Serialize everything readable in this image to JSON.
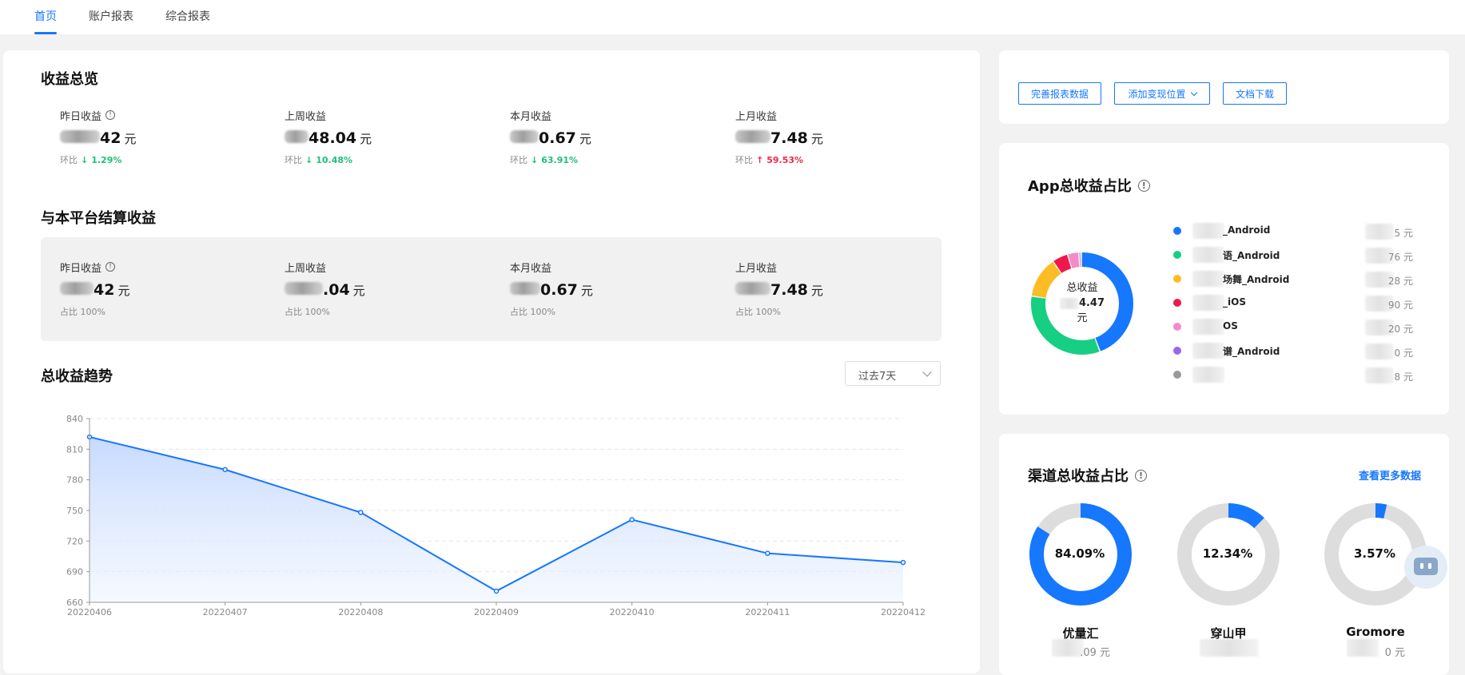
{
  "nav": {
    "tabs": [
      {
        "label": "首页",
        "active": true
      },
      {
        "label": "账户报表",
        "active": false
      },
      {
        "label": "综合报表",
        "active": false
      }
    ]
  },
  "overview": {
    "title": "收益总览",
    "stats": [
      {
        "label": "昨日收益",
        "value": "42",
        "unit": "元",
        "compare_label": "环比",
        "trend": "down",
        "trend_arrow": "↓",
        "change": "1.29%"
      },
      {
        "label": "上周收益",
        "value": "48.04",
        "unit": "元",
        "compare_label": "环比",
        "trend": "down",
        "trend_arrow": "↓",
        "change": "10.48%"
      },
      {
        "label": "本月收益",
        "value": "0.67",
        "unit": "元",
        "compare_label": "环比",
        "trend": "down",
        "trend_arrow": "↓",
        "change": "63.91%"
      },
      {
        "label": "上月收益",
        "value": "7.48",
        "unit": "元",
        "compare_label": "环比",
        "trend": "up",
        "trend_arrow": "↑",
        "change": "59.53%"
      }
    ]
  },
  "settlement": {
    "title": "与本平台结算收益",
    "stats": [
      {
        "label": "昨日收益",
        "value": "42",
        "unit": "元",
        "share": "占比 100%"
      },
      {
        "label": "上周收益",
        "value": ".04",
        "unit": "元",
        "share": "占比 100%"
      },
      {
        "label": "本月收益",
        "value": "0.67",
        "unit": "元",
        "share": "占比 100%"
      },
      {
        "label": "上月收益",
        "value": "7.48",
        "unit": "元",
        "share": "占比 100%"
      }
    ]
  },
  "trend": {
    "title": "总收益趋势",
    "range_select": "过去7天"
  },
  "chart_data": {
    "type": "area",
    "title": "",
    "x": [
      "20220406",
      "20220407",
      "20220408",
      "20220409",
      "20220410",
      "20220411",
      "20220412"
    ],
    "series": [
      {
        "values": [
          822,
          790,
          748,
          671,
          741,
          708,
          699
        ]
      }
    ],
    "xlabel": "",
    "ylabel": "",
    "ylim": [
      660,
      840
    ],
    "yticks": [
      840,
      810,
      780,
      750,
      720,
      690,
      660
    ],
    "grid": true,
    "colors": {
      "line": "#1677ff",
      "fill": "#cfe0ff"
    }
  },
  "actions": {
    "improve_data": "完善报表数据",
    "add_position": "添加变现位置",
    "doc_download": "文档下载"
  },
  "app_share": {
    "title": "App总收益占比",
    "center_label": "总收益",
    "center_value": "4.47",
    "center_unit": "元",
    "items": [
      {
        "name": "_Android",
        "amount": "5 元",
        "color": "#1677ff",
        "share": 0.445
      },
      {
        "name": "语_Android",
        "amount": "76 元",
        "color": "#17cf82",
        "share": 0.33
      },
      {
        "name": "场舞_Android",
        "amount": "28 元",
        "color": "#fbbd23",
        "share": 0.13
      },
      {
        "name": "_iOS",
        "amount": "90 元",
        "color": "#f0184a",
        "share": 0.05
      },
      {
        "name": "OS",
        "amount": "20 元",
        "color": "#f58ac9",
        "share": 0.035
      },
      {
        "name": "谱_Android",
        "amount": "0 元",
        "color": "#9b66ee",
        "share": 0.005
      },
      {
        "name": "",
        "amount": "8 元",
        "color": "#999999",
        "share": 0.005
      }
    ]
  },
  "channel_share": {
    "title": "渠道总收益占比",
    "more_link": "查看更多数据",
    "channels": [
      {
        "name": "优量汇",
        "percent_text": "84.09%",
        "percent": 84.09,
        "amount": ".09 元"
      },
      {
        "name": "穿山甲",
        "percent_text": "12.34%",
        "percent": 12.34,
        "amount": ""
      },
      {
        "name": "Gromore",
        "percent_text": "3.57%",
        "percent": 3.57,
        "amount": "0 元"
      }
    ]
  }
}
